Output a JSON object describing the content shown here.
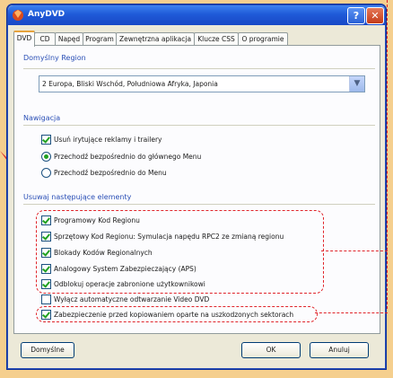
{
  "window": {
    "title": "AnyDVD",
    "help_glyph": "?",
    "close_glyph": "✕"
  },
  "tabs": [
    "DVD",
    "CD",
    "Napęd",
    "Program",
    "Zewnętrzna aplikacja",
    "Klucze CSS",
    "O programie"
  ],
  "region": {
    "group_title": "Domyślny Region",
    "selected": "2 Europa, Bliski Wschód, Południowa Afryka, Japonia"
  },
  "navigation": {
    "group_title": "Nawigacja",
    "remove_trailers": "Usuń irytujące reklamy i trailery",
    "go_main_menu": "Przechodź bezpośrednio do głównego Menu",
    "go_menu": "Przechodź bezpośrednio do Menu"
  },
  "remove": {
    "group_title": "Usuwaj następujące elementy",
    "items": [
      {
        "label": "Programowy Kod Regionu",
        "checked": true
      },
      {
        "label": "Sprzętowy Kod Regionu: Symulacja napędu RPC2 ze zmianą regionu",
        "checked": true
      },
      {
        "label": "Blokady Kodów Regionalnych",
        "checked": true
      },
      {
        "label": "Analogowy System Zabezpieczający (APS)",
        "checked": true
      },
      {
        "label": "Odblokuj operacje zabronione użytkownikowi",
        "checked": true
      },
      {
        "label": "Wyłącz automatyczne odtwarzanie Video DVD",
        "checked": false
      },
      {
        "label": "Zabezpieczenie przed kopiowaniem oparte na uszkodzonych sektorach",
        "checked": true
      }
    ]
  },
  "buttons": {
    "defaults": "Domyślne",
    "ok": "OK",
    "cancel": "Anuluj"
  },
  "colors": {
    "highlight": "#e0242a",
    "background": "#f5cf8e",
    "titlebar": "#1f5ad8"
  }
}
